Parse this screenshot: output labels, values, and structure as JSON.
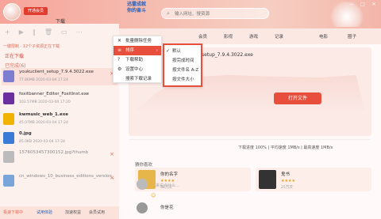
{
  "titlebar": {
    "vip_badge": "开通会员",
    "search_placeholder": "输入网址、搜资源",
    "promo_line1": "迅雷成就",
    "promo_line2": "你的奋斗",
    "window_buttons": [
      "—",
      "□",
      "✕"
    ],
    "menu_icon": "menu-icon"
  },
  "left": {
    "tab_downloading": "下载",
    "toolbar_icons": [
      "add-icon",
      "play-icon",
      "pause-icon",
      "delete-icon",
      "folder-icon",
      "more-icon"
    ],
    "status_text": "一键限制 · 12个子资源正在下载",
    "section_downloading": "正在下载",
    "section_completed": "已完成(6)",
    "items": [
      {
        "name": "youkuclient_setup_7.9.4.3022.exe",
        "meta": "77.86MB   2020-03-04 17:24",
        "color": "#7d7dd1"
      },
      {
        "name": "foxitbanner_Editor_FoxitInst.exe",
        "meta": "103.57MB  2020-03-04 17:20",
        "color": "#6b2fa0"
      },
      {
        "name": "kwmusic_web_1.exe",
        "meta": "45.07MB   2020-03-04 17:24",
        "color": "#f0b400"
      },
      {
        "name": "0.jpg",
        "meta": "85.0KB   2020-03-04 17:24",
        "color": "#3a7bd5"
      },
      {
        "name": "1576053457300152.jpg?thumb",
        "meta": "",
        "color": "#bbbbbb"
      },
      {
        "name": "cn_windows_10_business_editions_version_1909_x86_dvd_0ca...",
        "meta": "",
        "color": "#7aa5d8"
      }
    ],
    "bottom_left": "极速下载中",
    "bottom_mid": "试用体验",
    "bottom_right": "加速权益",
    "bottom_more": "会员试用"
  },
  "tabs": [
    "会员",
    "影视",
    "游戏",
    "记录",
    "电影",
    "圈子"
  ],
  "hero": {
    "filename": "setup_7.9.4.3022.exe",
    "open_label": "打开文件",
    "stats": "下载进度 100%  |  平均速度 1MB/s  |  最高速度 1MB/s"
  },
  "recommend": {
    "title": "猜你喜欢",
    "cards": [
      {
        "title": "你的名字",
        "stars": "★★★★",
        "views": "38万次",
        "color": "#e6b64a"
      },
      {
        "title": "鬼书",
        "stars": "★★★★",
        "views": "25万次",
        "color": "#333333"
      }
    ]
  },
  "comment": {
    "placeholder": "来说点什么...",
    "user": "你是花",
    "emoji_icon": "emoji-icon"
  },
  "menu1": {
    "items": [
      "批量删除任务",
      "排序",
      "下载帮助",
      "设置中心",
      "搜索下载记录"
    ],
    "icons": [
      "close-icon",
      "sort-icon",
      "help-icon",
      "settings-icon",
      "search-icon"
    ]
  },
  "menu2": {
    "items": [
      "默认",
      "按完成时间",
      "按文件名 A-Z",
      "按文件大小"
    ],
    "checked_index": 0
  },
  "colors": {
    "accent": "#e84e3c"
  }
}
